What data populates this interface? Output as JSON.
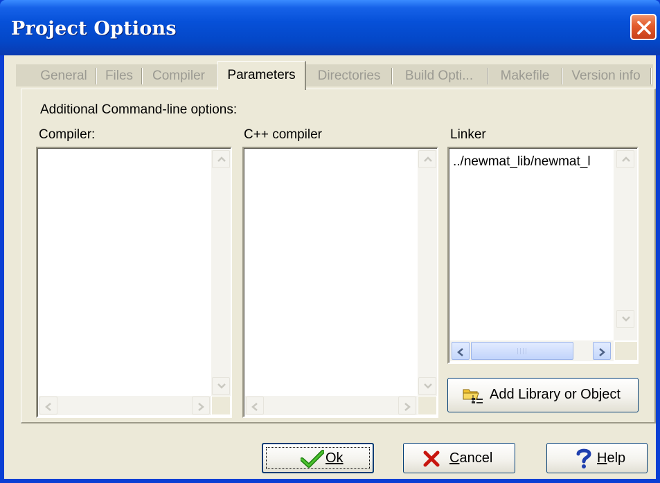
{
  "window": {
    "title": "Project Options",
    "close_icon": "close-icon"
  },
  "tabs": [
    {
      "label": "General",
      "active": false
    },
    {
      "label": "Files",
      "active": false
    },
    {
      "label": "Compiler",
      "active": false
    },
    {
      "label": "Parameters",
      "active": true
    },
    {
      "label": "Directories",
      "active": false
    },
    {
      "label": "Build Opti...",
      "active": false
    },
    {
      "label": "Makefile",
      "active": false
    },
    {
      "label": "Version info",
      "active": false
    }
  ],
  "parameters": {
    "heading": "Additional Command-line options:",
    "compiler": {
      "label": "Compiler:",
      "value": ""
    },
    "cpp_compiler": {
      "label": "C++ compiler",
      "value": ""
    },
    "linker": {
      "label": "Linker",
      "value": "../newmat_lib/newmat_l"
    },
    "add_library_button": {
      "label": "Add Library or Object",
      "icon": "folder-library-icon"
    }
  },
  "footer": {
    "ok_button": {
      "label": "Ok",
      "icon": "checkmark-icon"
    },
    "cancel_button": {
      "label": "Cancel",
      "icon": "x-icon"
    },
    "help_button": {
      "label": "Help",
      "icon": "question-icon"
    }
  },
  "colors": {
    "title_bar": "#0650d8",
    "dialog_bg": "#ece9d8",
    "close_button": "#e35b2b",
    "ok_check": "#2a9a1a",
    "cancel_x": "#c8160f",
    "help_question": "#1f3fae"
  }
}
